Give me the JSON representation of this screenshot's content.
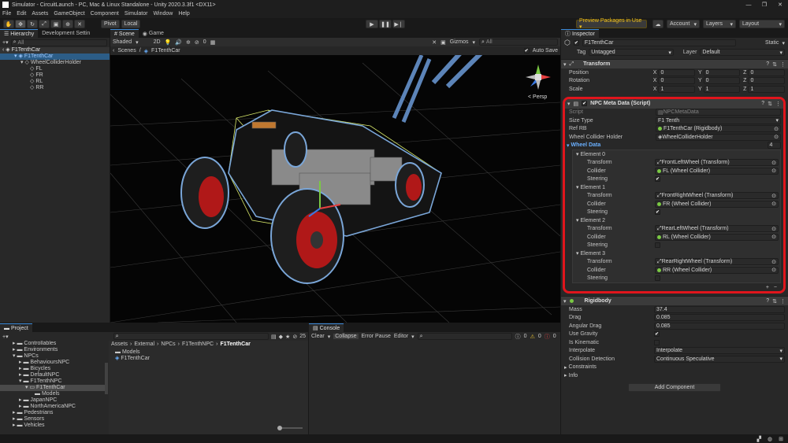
{
  "window": {
    "title": "Simulator - CircuitLaunch - PC, Mac & Linux Standalone - Unity 2020.3.3f1 <DX11>"
  },
  "menu": [
    "File",
    "Edit",
    "Assets",
    "GameObject",
    "Component",
    "Simulator",
    "Window",
    "Help"
  ],
  "toolbar": {
    "pivot": "Pivot",
    "local": "Local",
    "preview_packages": "Preview Packages in Use ▾",
    "account": "Account",
    "layers": "Layers",
    "layout": "Layout"
  },
  "hierarchy": {
    "tab": "Hierarchy",
    "tab2": "Development Settin",
    "search": "All",
    "items": [
      "F1TenthCar",
      "F1TenthCar",
      "WheelColliderHolder",
      "FL",
      "FR",
      "RL",
      "RR"
    ]
  },
  "scene": {
    "tab_scene": "Scene",
    "tab_game": "Game",
    "shading": "Shaded",
    "mode_2d": "2D",
    "fx_count": "0",
    "gizmos": "Gizmos",
    "search": "All",
    "breadcrumb_root": "Scenes",
    "breadcrumb_item": "F1TenthCar",
    "auto_save": "Auto Save",
    "persp": "< Persp"
  },
  "project": {
    "tab": "Project",
    "count": "25",
    "folders": [
      "Controllables",
      "Environments",
      "NPCs",
      "BehavioursNPC",
      "Bicycles",
      "DefaultNPC",
      "F1TenthNPC",
      "F1TenthCar",
      "Models",
      "JapanNPC",
      "NorthAmericaNPC",
      "Pedestrians",
      "Sensors",
      "Vehicles"
    ],
    "path": [
      "Assets",
      "External",
      "NPCs",
      "F1TenthNPC",
      "F1TenthCar"
    ],
    "files": [
      "Models",
      "F1TenthCar"
    ]
  },
  "console": {
    "tab": "Console",
    "clear": "Clear",
    "collapse": "Collapse",
    "error_pause": "Error Pause",
    "editor": "Editor",
    "counts": [
      "0",
      "0",
      "0"
    ]
  },
  "inspector": {
    "tab": "Inspector",
    "object_name": "F1TenthCar",
    "static": "Static",
    "tag_label": "Tag",
    "tag_value": "Untagged",
    "layer_label": "Layer",
    "layer_value": "Default",
    "transform": {
      "title": "Transform",
      "position_label": "Position",
      "rotation_label": "Rotation",
      "scale_label": "Scale",
      "position": [
        "0",
        "0",
        "0"
      ],
      "rotation": [
        "0",
        "0",
        "0"
      ],
      "scale": [
        "1",
        "1",
        "1"
      ]
    },
    "npc_meta": {
      "title": "NPC Meta Data (Script)",
      "script_label": "Script",
      "script_value": "NPCMetaData",
      "size_type_label": "Size Type",
      "size_type_value": "F1 Tenth",
      "ref_rb_label": "Ref RB",
      "ref_rb_value": "F1TenthCar (Rigidbody)",
      "wheel_holder_label": "Wheel Collider Holder",
      "wheel_holder_value": "WheelColliderHolder",
      "wheel_data_label": "Wheel Data",
      "wheel_data_count": "4",
      "transform_label": "Transform",
      "collider_label": "Collider",
      "steering_label": "Steering",
      "elements": [
        {
          "name": "Element 0",
          "transform": "FrontLeftWheel (Transform)",
          "collider": "FL (Wheel Collider)",
          "steering": "✔"
        },
        {
          "name": "Element 1",
          "transform": "FrontRightWheel (Transform)",
          "collider": "FR (Wheel Collider)",
          "steering": "✔"
        },
        {
          "name": "Element 2",
          "transform": "RearLeftWheel (Transform)",
          "collider": "RL (Wheel Collider)",
          "steering": ""
        },
        {
          "name": "Element 3",
          "transform": "RearRightWheel (Transform)",
          "collider": "RR (Wheel Collider)",
          "steering": ""
        }
      ]
    },
    "rigidbody": {
      "title": "Rigidbody",
      "mass_label": "Mass",
      "mass": "37.4",
      "drag_label": "Drag",
      "drag": "0.085",
      "angular_drag_label": "Angular Drag",
      "angular_drag": "0.085",
      "use_gravity_label": "Use Gravity",
      "use_gravity": "✔",
      "is_kinematic_label": "Is Kinematic",
      "interpolate_label": "Interpolate",
      "interpolate": "Interpolate",
      "collision_label": "Collision Detection",
      "collision": "Continuous Speculative",
      "constraints": "Constraints",
      "info": "Info"
    },
    "add_component": "Add Component"
  },
  "colors": {
    "highlight": "#e0151c",
    "selection": "#2c5d87",
    "accent": "#3c8ad8"
  }
}
